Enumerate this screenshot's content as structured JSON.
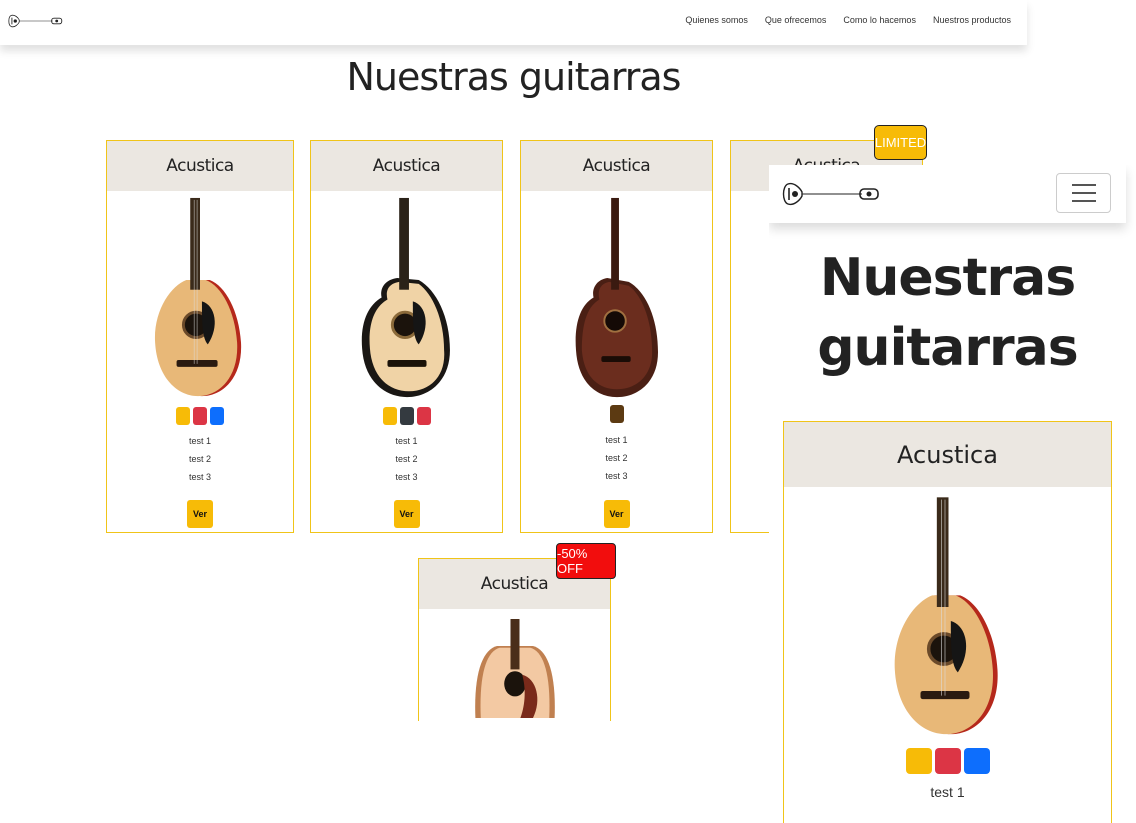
{
  "nav": {
    "links": [
      "Quienes somos",
      "Que ofrecemos",
      "Como lo hacemos",
      "Nuestros productos"
    ]
  },
  "page": {
    "title": "Nuestras guitarras"
  },
  "colors": {
    "accent": "#f7bb07",
    "card_border": "#f0c419",
    "card_header": "#ebe7e1",
    "sale_badge": "#f20d0d",
    "swatch_yellow": "#f7bb07",
    "swatch_red": "#dc3545",
    "swatch_blue": "#0d6efd",
    "swatch_dark": "#343a40",
    "swatch_brown": "#5c3a12"
  },
  "products": [
    {
      "name": "Acustica",
      "image": "natural-guitar-red-sides",
      "swatches": [
        "yellow",
        "red",
        "blue"
      ],
      "features": [
        "test 1",
        "test 2",
        "test 3"
      ],
      "button": "Ver"
    },
    {
      "name": "Acustica",
      "image": "natural-cutaway-guitar",
      "swatches": [
        "yellow",
        "dark",
        "red"
      ],
      "features": [
        "test 1",
        "test 2",
        "test 3"
      ],
      "button": "Ver"
    },
    {
      "name": "Acustica",
      "image": "brown-cutaway-guitar",
      "swatches": [
        "brown"
      ],
      "features": [
        "test 1",
        "test 2",
        "test 3"
      ],
      "button": "Ver"
    },
    {
      "name": "Acustica",
      "badge": "LIMITED"
    },
    {
      "name": "Acustica",
      "image": "dreadnought-guitar",
      "badge": "-50% OFF"
    }
  ],
  "mobile": {
    "title": "Nuestras guitarras",
    "card": {
      "name": "Acustica",
      "image": "natural-guitar-red-sides",
      "swatches": [
        "yellow",
        "red",
        "blue"
      ],
      "feature": "test 1"
    }
  }
}
